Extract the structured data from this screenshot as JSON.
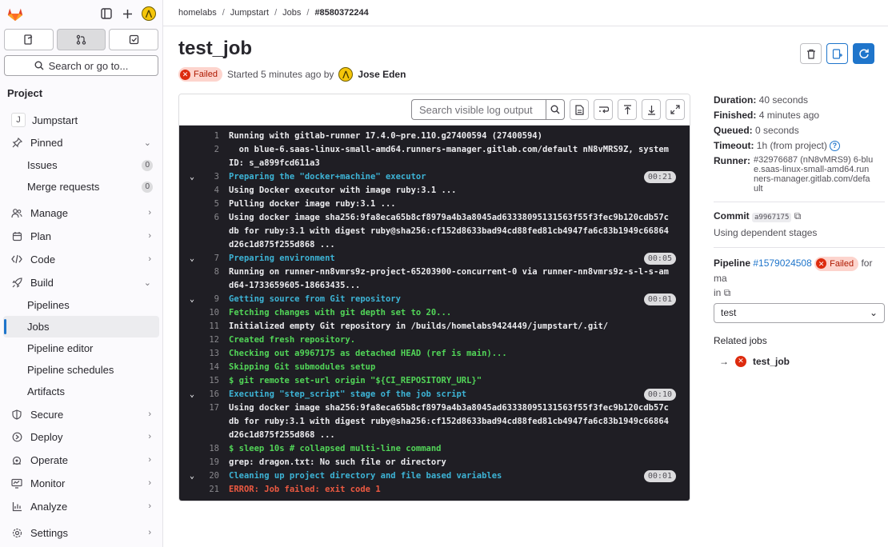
{
  "breadcrumb": [
    "homelabs",
    "Jumpstart",
    "Jobs",
    "#8580372244"
  ],
  "sidebar": {
    "search_label": "Search or go to...",
    "section": "Project",
    "project": {
      "initial": "J",
      "name": "Jumpstart"
    },
    "pinned": "Pinned",
    "pinned_items": [
      {
        "label": "Issues",
        "count": "0"
      },
      {
        "label": "Merge requests",
        "count": "0"
      }
    ],
    "items": [
      "Manage",
      "Plan",
      "Code",
      "Build"
    ],
    "build_items": [
      "Pipelines",
      "Jobs",
      "Pipeline editor",
      "Pipeline schedules",
      "Artifacts"
    ],
    "lower_items": [
      "Secure",
      "Deploy",
      "Operate",
      "Monitor",
      "Analyze"
    ],
    "settings": "Settings"
  },
  "job": {
    "title": "test_job",
    "status": "Failed",
    "started": "Started 5 minutes ago by",
    "author": "Jose Eden"
  },
  "log_toolbar": {
    "search_placeholder": "Search visible log output"
  },
  "log": [
    {
      "n": "1",
      "t": "Running with gitlab-runner 17.4.0~pre.110.g27400594 (27400594)",
      "c": ""
    },
    {
      "n": "2",
      "t": "  on blue-6.saas-linux-small-amd64.runners-manager.gitlab.com/default nN8vMRS9Z, system ID: s_a899fcd611a3",
      "c": ""
    },
    {
      "n": "3",
      "t": "Preparing the \"docker+machine\" executor",
      "c": "sec",
      "dur": "00:21"
    },
    {
      "n": "4",
      "t": "Using Docker executor with image ruby:3.1 ...",
      "c": ""
    },
    {
      "n": "5",
      "t": "Pulling docker image ruby:3.1 ...",
      "c": ""
    },
    {
      "n": "6",
      "t": "Using docker image sha256:9fa8eca65b8cf8979a4b3a8045ad63338095131563f55f3fec9b120cdb57cdb for ruby:3.1 with digest ruby@sha256:cf152d8633bad94cd88fed81cb4947fa6c83b1949c66864d26c1d875f255d868 ...",
      "c": ""
    },
    {
      "n": "7",
      "t": "Preparing environment",
      "c": "sec",
      "dur": "00:05"
    },
    {
      "n": "8",
      "t": "Running on runner-nn8vmrs9z-project-65203900-concurrent-0 via runner-nn8vmrs9z-s-l-s-amd64-1733659605-18663435...",
      "c": ""
    },
    {
      "n": "9",
      "t": "Getting source from Git repository",
      "c": "sec",
      "dur": "00:01"
    },
    {
      "n": "10",
      "t": "Fetching changes with git depth set to 20...",
      "c": "grn"
    },
    {
      "n": "11",
      "t": "Initialized empty Git repository in /builds/homelabs9424449/jumpstart/.git/",
      "c": ""
    },
    {
      "n": "12",
      "t": "Created fresh repository.",
      "c": "grn"
    },
    {
      "n": "13",
      "t": "Checking out a9967175 as detached HEAD (ref is main)...",
      "c": "grn"
    },
    {
      "n": "14",
      "t": "Skipping Git submodules setup",
      "c": "grn"
    },
    {
      "n": "15",
      "t": "$ git remote set-url origin \"${CI_REPOSITORY_URL}\"",
      "c": "grn"
    },
    {
      "n": "16",
      "t": "Executing \"step_script\" stage of the job script",
      "c": "sec",
      "dur": "00:10"
    },
    {
      "n": "17",
      "t": "Using docker image sha256:9fa8eca65b8cf8979a4b3a8045ad63338095131563f55f3fec9b120cdb57cdb for ruby:3.1 with digest ruby@sha256:cf152d8633bad94cd88fed81cb4947fa6c83b1949c66864d26c1d875f255d868 ...",
      "c": ""
    },
    {
      "n": "18",
      "t": "$ sleep 10s # collapsed multi-line command",
      "c": "grn"
    },
    {
      "n": "19",
      "t": "grep: dragon.txt: No such file or directory",
      "c": ""
    },
    {
      "n": "20",
      "t": "Cleaning up project directory and file based variables",
      "c": "sec",
      "dur": "00:01"
    },
    {
      "n": "21",
      "t": "ERROR: Job failed: exit code 1",
      "c": "red"
    }
  ],
  "details": {
    "duration_label": "Duration:",
    "duration": "40 seconds",
    "finished_label": "Finished:",
    "finished": "4 minutes ago",
    "queued_label": "Queued:",
    "queued": "0 seconds",
    "timeout_label": "Timeout:",
    "timeout": "1h (from project)",
    "runner_label": "Runner:",
    "runner": "#32976687 (nN8vMRS9) 6-blue.saas-linux-small-amd64.runners-manager.gitlab.com/default",
    "commit_label": "Commit",
    "commit_sha": "a9967175",
    "commit_msg": "Using dependent stages",
    "pipeline_label": "Pipeline",
    "pipeline_id": "#1579024508",
    "pipeline_status": "Failed",
    "pipeline_ref_pre": "for ma",
    "pipeline_ref_post": "in",
    "stage_select": "test",
    "related_label": "Related jobs",
    "related_job": "test_job"
  },
  "colors": {
    "accent": "#1f75cb",
    "failed": "#dd2b0e",
    "log_bg": "#1f1e24"
  }
}
